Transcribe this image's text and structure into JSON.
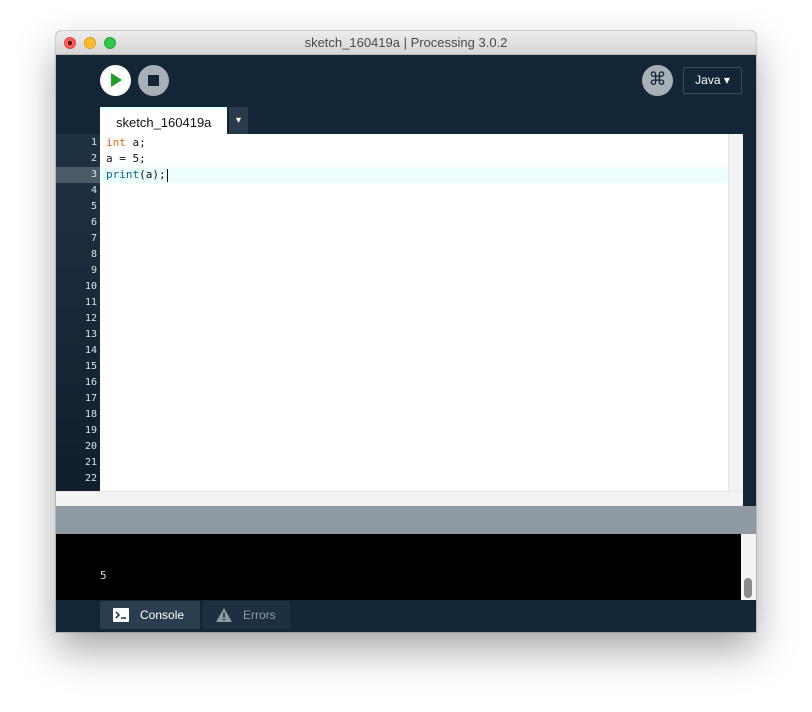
{
  "window": {
    "title": "sketch_160419a | Processing 3.0.2"
  },
  "toolbar": {
    "run_icon": "play-icon",
    "stop_icon": "stop-icon",
    "debug_icon": "butterfly-debug-icon",
    "debug_glyph": "⌘",
    "mode_label": "Java ▾"
  },
  "tabs": {
    "active_label": "sketch_160419a",
    "menu_arrow": "▾"
  },
  "editor": {
    "line_numbers": [
      "1",
      "2",
      "3",
      "4",
      "5",
      "6",
      "7",
      "8",
      "9",
      "10",
      "11",
      "12",
      "13",
      "14",
      "15",
      "16",
      "17",
      "18",
      "19",
      "20",
      "21",
      "22"
    ],
    "current_line": 3,
    "code": {
      "line1_keyword": "int",
      "line1_rest": " a;",
      "line2": "a = 5;",
      "line3_func": "print",
      "line3_rest": "(a);"
    }
  },
  "console": {
    "output": "5"
  },
  "footer": {
    "console_label": "Console",
    "errors_label": "Errors"
  },
  "colors": {
    "window_bg": "#132638",
    "keyword": "#e2661a",
    "function": "#006699",
    "run_icon": "#20a020"
  }
}
